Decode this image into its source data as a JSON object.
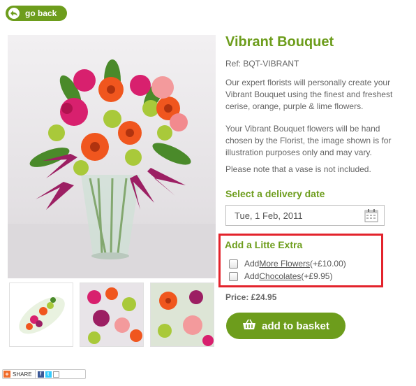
{
  "nav": {
    "back_label": "go back"
  },
  "product": {
    "title": "Vibrant Bouquet",
    "ref": "Ref: BQT-VIBRANT",
    "description_1": "Our expert florists will personally create your Vibrant Bouquet using the finest and freshest cerise, orange, purple & lime flowers.",
    "description_2": "Your Vibrant Bouquet flowers will be hand chosen by the Florist, the image shown is for illustration purposes only and may vary.",
    "description_3": "Please note that a vase is not included."
  },
  "delivery": {
    "heading": "Select a delivery date",
    "date_value": "Tue, 1 Feb, 2011"
  },
  "extras": {
    "heading": "Add a Litte Extra",
    "items": [
      {
        "prefix": "Add ",
        "link": "More Flowers",
        "price": " (+£10.00)"
      },
      {
        "prefix": "Add ",
        "link": "Chocolates",
        "price": " (+£9.95)"
      }
    ]
  },
  "price_label": "Price: £24.95",
  "basket_label": "add to basket",
  "share": {
    "label": "SHARE"
  },
  "colors": {
    "brand_green": "#6d9d1c",
    "highlight_red": "#e3232c",
    "text_grey": "#666666"
  },
  "icons": [
    "back-arrow-icon",
    "calendar-icon",
    "basket-icon",
    "share-plus-icon",
    "facebook-icon",
    "twitter-icon",
    "email-icon"
  ]
}
